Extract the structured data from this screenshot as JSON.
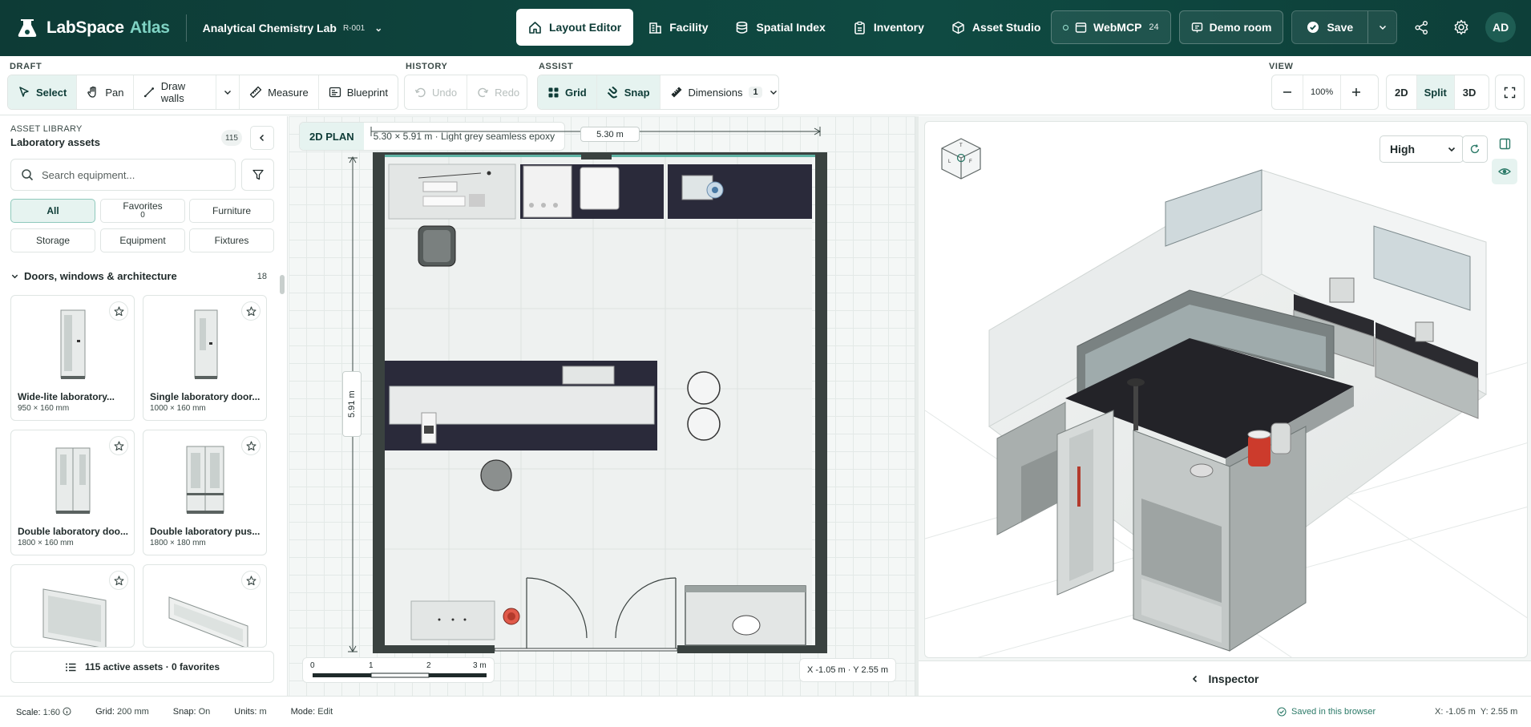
{
  "app": {
    "name": "LabSpace",
    "accent_name": "Atlas"
  },
  "project": {
    "name": "Analytical Chemistry Lab",
    "code": "R-001"
  },
  "nav_tabs": [
    {
      "label": "Layout Editor",
      "icon": "home-icon",
      "active": true
    },
    {
      "label": "Facility",
      "icon": "building-icon"
    },
    {
      "label": "Spatial Index",
      "icon": "database-icon"
    },
    {
      "label": "Inventory",
      "icon": "clipboard-icon"
    },
    {
      "label": "Asset Studio",
      "icon": "cube-icon"
    }
  ],
  "header_actions": {
    "webmcp_label": "WebMCP",
    "webmcp_count": "24",
    "demo_label": "Demo room",
    "save_label": "Save",
    "avatar": "AD"
  },
  "toolbar": {
    "draft_label": "DRAFT",
    "history_label": "HISTORY",
    "assist_label": "ASSIST",
    "view_label": "VIEW",
    "select": "Select",
    "pan": "Pan",
    "draw_walls": "Draw walls",
    "measure": "Measure",
    "blueprint": "Blueprint",
    "undo": "Undo",
    "redo": "Redo",
    "grid": "Grid",
    "snap": "Snap",
    "dimensions": "Dimensions",
    "dimensions_count": "1",
    "zoom": "100%",
    "mode_2d": "2D",
    "mode_split": "Split",
    "mode_3d": "3D"
  },
  "library": {
    "kicker": "ASSET LIBRARY",
    "title": "Laboratory assets",
    "count": "115",
    "search_placeholder": "Search equipment...",
    "chips": {
      "all": "All",
      "favorites": "Favorites",
      "favorites_count": "0",
      "furniture": "Furniture",
      "storage": "Storage",
      "equipment": "Equipment",
      "fixtures": "Fixtures"
    },
    "section_title": "Doors, windows & architecture",
    "section_count": "18",
    "items": [
      {
        "name": "Wide-lite laboratory...",
        "dims": "950 × 160 mm"
      },
      {
        "name": "Single laboratory door...",
        "dims": "1000 × 160 mm"
      },
      {
        "name": "Double laboratory doo...",
        "dims": "1800 × 160 mm"
      },
      {
        "name": "Double laboratory pus...",
        "dims": "1800 × 180 mm"
      },
      {
        "name": "",
        "dims": ""
      },
      {
        "name": "",
        "dims": ""
      }
    ],
    "footer": "115 active assets · 0 favorites"
  },
  "plan": {
    "label": "2D PLAN",
    "description": "5.30 × 5.91 m · Light grey seamless epoxy",
    "width_label": "5.30 m",
    "height_label": "5.91 m",
    "scale_ticks": [
      "0",
      "1",
      "2",
      "3 m"
    ],
    "coord": "X -1.05 m · Y 2.55 m"
  },
  "view3d": {
    "quality": "High"
  },
  "inspector": {
    "label": "Inspector"
  },
  "status": {
    "scale_lbl": "Scale:",
    "scale": "1:60",
    "grid_lbl": "Grid:",
    "grid": "200 mm",
    "snap_lbl": "Snap:",
    "snap": "On",
    "units_lbl": "Units:",
    "units": "m",
    "mode_lbl": "Mode:",
    "mode": "Edit",
    "saved": "Saved in this browser",
    "x": "X: -1.05 m",
    "y": "Y: 2.55 m"
  },
  "colors": {
    "brand": "#0f4a42",
    "accent": "#7fd3c4",
    "wall": "#3a4240",
    "bench": "#2a2a3a"
  }
}
